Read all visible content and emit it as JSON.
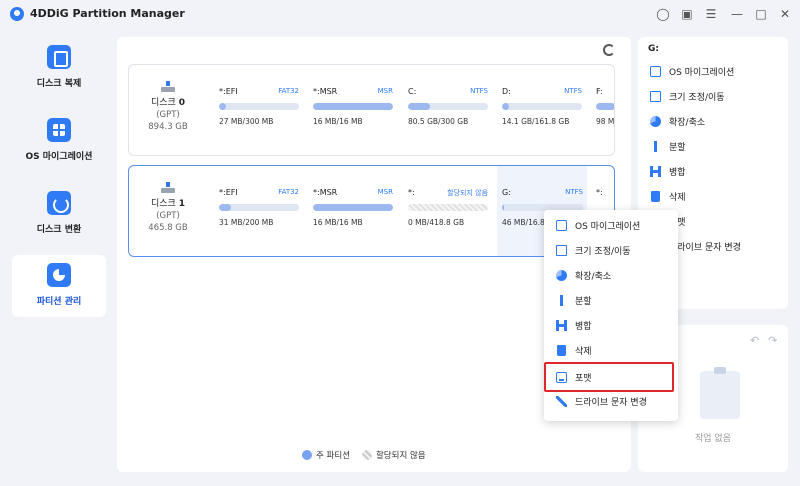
{
  "app": {
    "title": "4DDiG Partition Manager"
  },
  "sidebar": {
    "items": [
      {
        "label": "디스크 복제",
        "icon": "disk-copy-icon"
      },
      {
        "label": "OS 마이그레이션",
        "icon": "windows-icon"
      },
      {
        "label": "디스크 변환",
        "icon": "convert-icon"
      },
      {
        "label": "파티션 관리",
        "icon": "partition-icon",
        "active": true
      }
    ]
  },
  "disks": [
    {
      "name": "디스크",
      "num": "0",
      "type": "(GPT)",
      "size": "894.3 GB",
      "partitions": [
        {
          "name": "*:EFI",
          "fs": "FAT32",
          "size": "27 MB/300 MB",
          "used": 0.09
        },
        {
          "name": "*:MSR",
          "fs": "MSR",
          "size": "16 MB/16 MB",
          "used": 1.0
        },
        {
          "name": "C:",
          "fs": "NTFS",
          "size": "80.5 GB/300 GB",
          "used": 0.27
        },
        {
          "name": "D:",
          "fs": "NTFS",
          "size": "14.1 GB/161.8 GB",
          "used": 0.09
        },
        {
          "name": "F:",
          "fs": "",
          "size": "98 M",
          "used": 0.5
        }
      ]
    },
    {
      "name": "디스크",
      "num": "1",
      "type": "(GPT)",
      "size": "465.8 GB",
      "partitions": [
        {
          "name": "*:EFI",
          "fs": "FAT32",
          "size": "31 MB/200 MB",
          "used": 0.15
        },
        {
          "name": "*:MSR",
          "fs": "MSR",
          "size": "16 MB/16 MB",
          "used": 1.0
        },
        {
          "name": "*:",
          "fs": "할당되지 않음",
          "size": "0 MB/418.8 GB",
          "used": 0,
          "unallocated": true
        },
        {
          "name": "G:",
          "fs": "NTFS",
          "size": "46 MB/16.8 GB",
          "used": 0.03
        },
        {
          "name": "*:",
          "fs": "",
          "size": "",
          "used": 0
        }
      ]
    }
  ],
  "legend": {
    "primary": "주 파티션",
    "unallocated": "할당되지 않음"
  },
  "rightPanel": {
    "title": "G:",
    "items": [
      {
        "label": "OS 마이그레이션",
        "icon": "monitor-icon"
      },
      {
        "label": "크기 조정/이동",
        "icon": "resize-icon"
      },
      {
        "label": "확장/축소",
        "icon": "pie-icon"
      },
      {
        "label": "분할",
        "icon": "split-icon"
      },
      {
        "label": "병합",
        "icon": "merge-icon"
      },
      {
        "label": "삭제",
        "icon": "trash-icon"
      },
      {
        "label": "포맷",
        "icon": "format-icon"
      },
      {
        "label": "드라이브 문자 변경",
        "icon": "pen-icon"
      }
    ]
  },
  "history": {
    "title": "스트",
    "empty": "작업 없음"
  },
  "contextMenu": {
    "items": [
      {
        "label": "OS 마이그레이션",
        "icon": "monitor-icon"
      },
      {
        "label": "크기 조정/이동",
        "icon": "resize-icon"
      },
      {
        "label": "확장/축소",
        "icon": "pie-icon"
      },
      {
        "label": "분할",
        "icon": "split-icon"
      },
      {
        "label": "병합",
        "icon": "merge-icon"
      },
      {
        "label": "삭제",
        "icon": "trash-icon"
      },
      {
        "label": "포맷",
        "icon": "format-icon",
        "highlighted": true
      },
      {
        "label": "드라이브 문자 변경",
        "icon": "pen-icon"
      }
    ]
  },
  "colors": {
    "accent": "#2f7bf6",
    "highlight": "#e0262a",
    "barFill": "#9cb8ee"
  }
}
